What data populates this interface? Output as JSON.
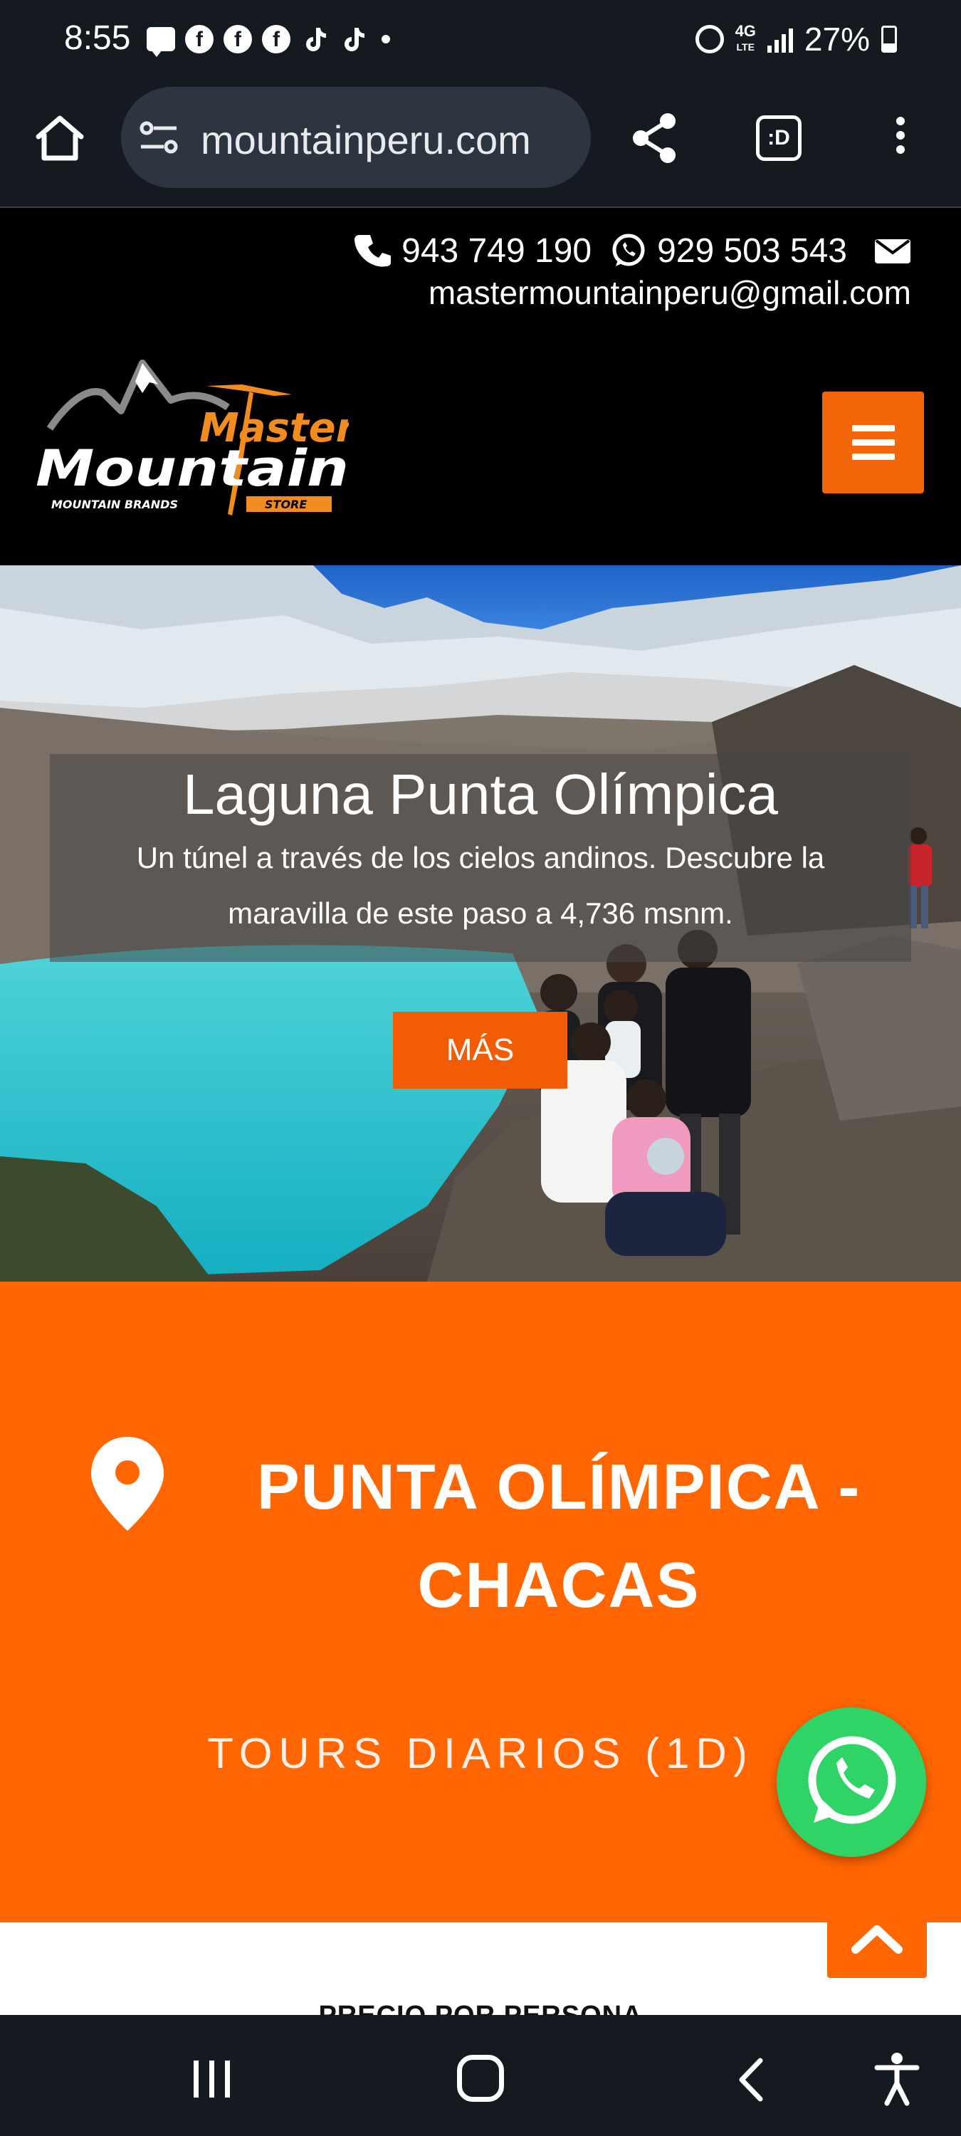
{
  "status_bar": {
    "time": "8:55",
    "network": "4G",
    "network_sub": "LTE",
    "battery": "27%",
    "notification_icons": [
      "message-icon",
      "facebook-icon",
      "facebook-icon",
      "facebook-icon",
      "tiktok-icon",
      "tiktok-icon",
      "dot-icon"
    ]
  },
  "browser": {
    "url": "mountainperu.com",
    "tabs_label": ":D"
  },
  "header": {
    "phone": "943 749 190",
    "whatsapp": "929 503 543",
    "email": "mastermountainperu@gmail.com",
    "logo": {
      "line1": "Master",
      "line2": "Mountain",
      "tagline": "MOUNTAIN BRANDS",
      "badge": "STORE"
    }
  },
  "hero": {
    "title": "Laguna Punta Olímpica",
    "subtitle": "Un túnel a través de los cielos andinos. Descubre la maravilla de este paso a 4,736 msnm.",
    "button": "MÁS"
  },
  "tour": {
    "title": "PUNTA OLÍMPICA - CHACAS",
    "category": "TOURS DIARIOS (1D)",
    "price_label": "PRECIO POR PERSONA"
  },
  "colors": {
    "brand_orange": "#ff6500",
    "button_orange": "#f25c05",
    "whatsapp_green": "#2fd366",
    "chrome_bg": "#141a20"
  }
}
